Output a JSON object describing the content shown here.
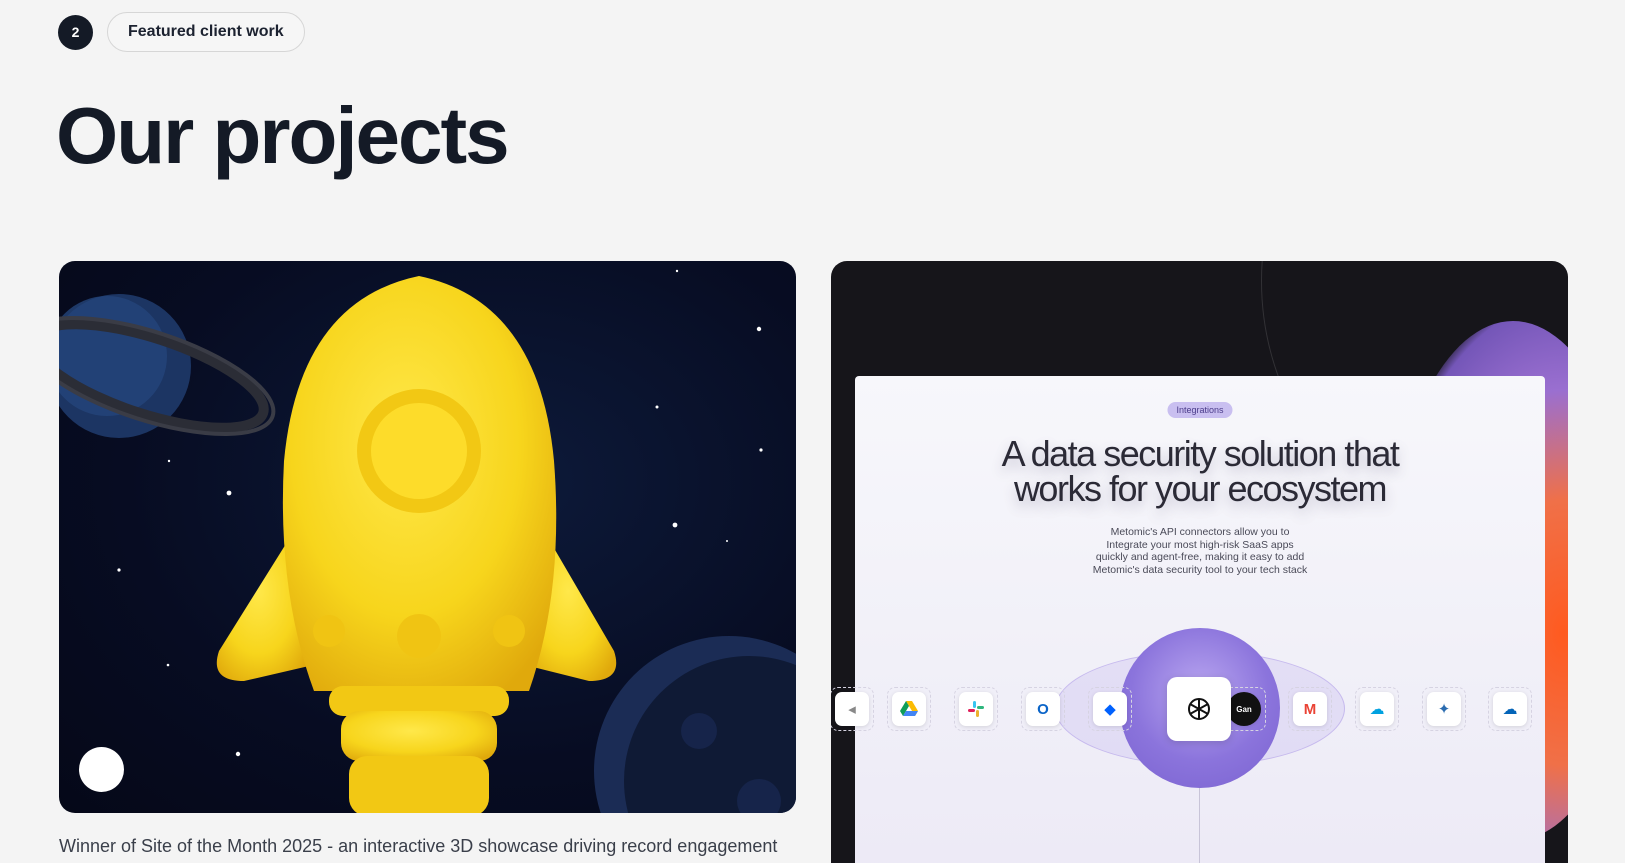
{
  "section": {
    "number": "2",
    "tag_label": "Featured client work"
  },
  "page_title": "Our projects",
  "projects": [
    {
      "caption": "Winner of Site of the Month 2025 - an interactive 3D showcase driving record engagement",
      "image": "rocket-space-scene"
    },
    {
      "caption": "",
      "image": "metomic-website",
      "screen": {
        "chip": "Integrations",
        "heading_line1": "A data security solution that",
        "heading_line2": "works for your ecosystem",
        "body_lines": [
          "Metomic's API connectors allow you to",
          "Integrate your most high-risk SaaS apps",
          "quickly and agent-free, making it easy to add",
          "Metomic's data security tool to your tech stack"
        ],
        "apps": [
          "google-drive",
          "slack",
          "outlook",
          "dropbox",
          "openai",
          "gan",
          "gmail",
          "salesforce",
          "azure",
          "onedrive"
        ]
      }
    }
  ],
  "colors": {
    "page_bg": "#f4f4f4",
    "title": "#141a26",
    "rocket_yellow": "#f7d51c",
    "accent_purple": "#8b74dc",
    "accent_orange": "#ff5a1f"
  }
}
